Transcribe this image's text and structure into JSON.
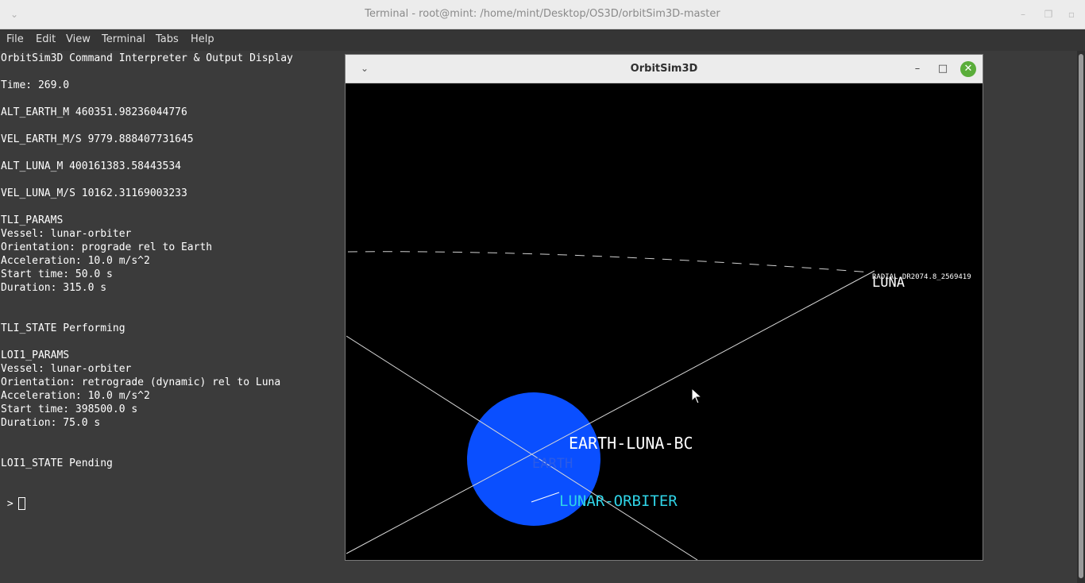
{
  "window": {
    "title": "Terminal - root@mint: /home/mint/Desktop/OS3D/orbitSim3D-master",
    "controls": {
      "minimize": "–",
      "restore": "❐",
      "close": "▫"
    }
  },
  "menu": [
    "File",
    "Edit",
    "View",
    "Terminal",
    "Tabs",
    "Help"
  ],
  "terminal": {
    "lines": [
      "OrbitSim3D Command Interpreter & Output Display",
      "",
      "Time: 269.0",
      "",
      "ALT_EARTH_M 460351.98236044776",
      "",
      "VEL_EARTH_M/S 9779.888407731645",
      "",
      "ALT_LUNA_M 400161383.58443534",
      "",
      "VEL_LUNA_M/S 10162.31169003233",
      "",
      "TLI_PARAMS",
      "Vessel: lunar-orbiter",
      "Orientation: prograde rel to Earth",
      "Acceleration: 10.0 m/s^2",
      "Start time: 50.0 s",
      "Duration: 315.0 s",
      "",
      "",
      "TLI_STATE Performing",
      "",
      "LOI1_PARAMS",
      "Vessel: lunar-orbiter",
      "Orientation: retrograde (dynamic) rel to Luna",
      "Acceleration: 10.0 m/s^2",
      "Start time: 398500.0 s",
      "Duration: 75.0 s",
      "",
      "",
      "LOI1_STATE Pending",
      "",
      "",
      " > "
    ]
  },
  "sim_window": {
    "title": "OrbitSim3D",
    "controls": {
      "minimize": "–",
      "maximize": "□",
      "close": "✕"
    },
    "labels": {
      "luna": "LUNA",
      "luna_info": "RADIAL DR2074.8_2569419",
      "earth": "EARTH",
      "barycenter": "EARTH-LUNA-BC",
      "orbiter": "LUNAR-ORBITER"
    },
    "colors": {
      "earth": "#0a4fff",
      "orbiter_label": "#2fd3e6",
      "line": "#d8d8d8",
      "background": "#000000"
    }
  }
}
